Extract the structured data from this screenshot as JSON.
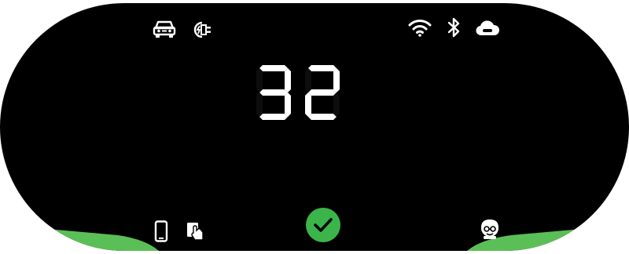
{
  "display": {
    "value": "32",
    "digits": [
      "3",
      "2"
    ],
    "status": "ok"
  },
  "top_bar": {
    "left_icons": [
      "car-icon",
      "ev-plug-icon"
    ],
    "right_icons": [
      "wifi-icon",
      "bluetooth-icon",
      "cloud-icon"
    ]
  },
  "bottom_bar": {
    "left_icons": [
      "phone-icon",
      "rfid-card-icon"
    ],
    "center_icon": "checkmark-circle-icon",
    "right_icons": [
      "technician-icon"
    ]
  },
  "colors": {
    "panel": "#000000",
    "segment_on": "#ffffff",
    "segment_dim": "#0d0d0d",
    "accent_green": "#5bbf57",
    "check_green": "#3bb54a"
  }
}
